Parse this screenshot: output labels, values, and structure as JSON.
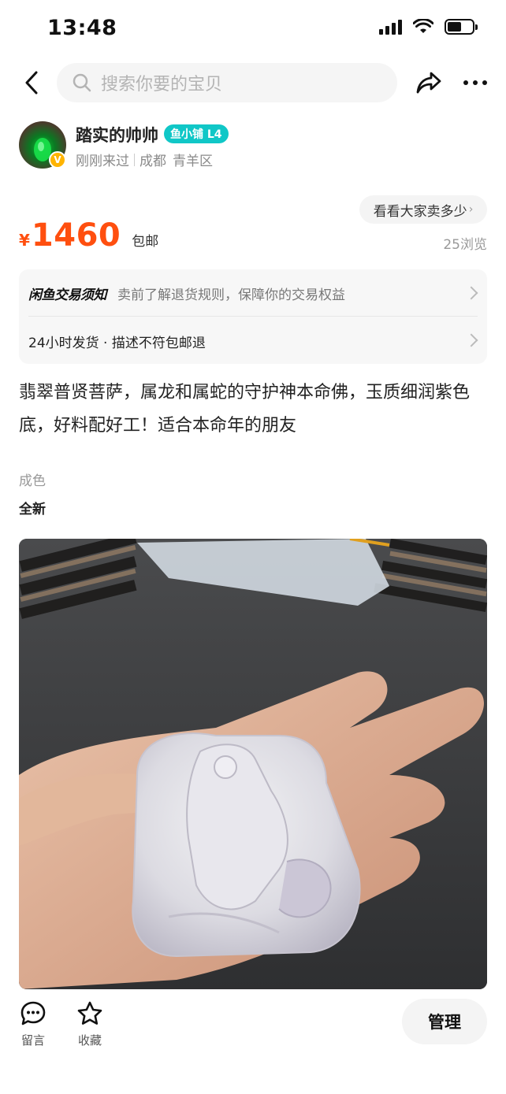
{
  "status_bar": {
    "time": "13:48",
    "battery_level": 0.55
  },
  "nav": {
    "search_placeholder": "搜索你要的宝贝"
  },
  "seller": {
    "name": "踏实的帅帅",
    "badge": "鱼小铺 L4",
    "verified_mark": "V",
    "last_visit": "刚刚来过",
    "city": "成都",
    "district": "青羊区"
  },
  "price": {
    "see_others_label": "看看大家卖多少",
    "currency": "¥",
    "value": "1460",
    "shipping": "包邮",
    "views": "25浏览"
  },
  "notice": {
    "brand": "闲鱼交易须知",
    "text": "卖前了解退货规则，保障你的交易权益",
    "policy": "24小时发货 · 描述不符包邮退"
  },
  "description": "翡翠普贤菩萨，属龙和属蛇的守护神本命佛，玉质细润紫色底，好料配好工！适合本命年的朋友",
  "condition": {
    "label": "成色",
    "value": "全新"
  },
  "bottom_bar": {
    "comment_label": "留言",
    "favorite_label": "收藏",
    "manage_label": "管理"
  },
  "colors": {
    "price": "#ff4f0f",
    "badge": "#10c7c7",
    "verified": "#ffb400"
  },
  "icons": [
    "back-arrow-icon",
    "search-icon",
    "share-icon",
    "more-icon",
    "comment-icon",
    "star-icon",
    "chevron-right-icon"
  ]
}
